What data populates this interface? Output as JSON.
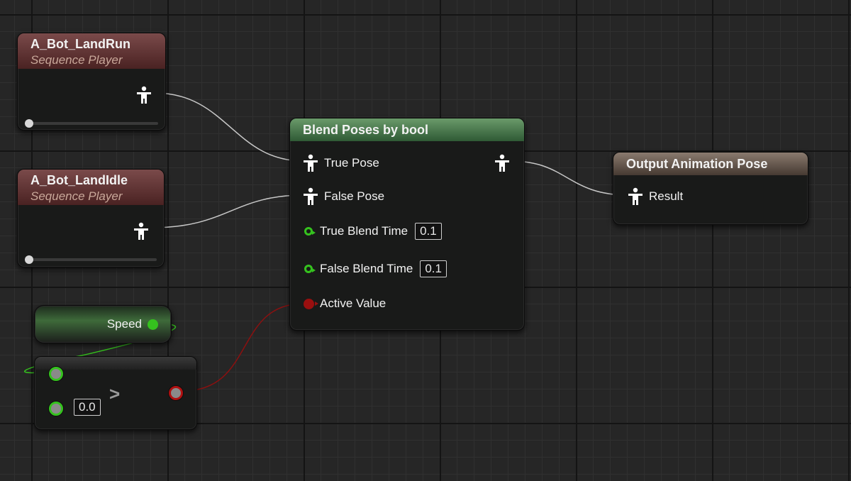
{
  "colors": {
    "graph_bg": "#262626",
    "float_pin": "#35c21e",
    "bool_pin": "#9a0f0f",
    "sequence_header": "#6e3e3e",
    "blend_header": "#4a7a4e",
    "output_header": "#7a6a60"
  },
  "nodes": {
    "land_run": {
      "title": "A_Bot_LandRun",
      "subtitle": "Sequence Player",
      "output_pin_icon": "pose-icon"
    },
    "land_idle": {
      "title": "A_Bot_LandIdle",
      "subtitle": "Sequence Player",
      "output_pin_icon": "pose-icon"
    },
    "blend": {
      "title": "Blend Poses by bool",
      "true_pose": "True Pose",
      "false_pose": "False Pose",
      "true_blend_time": "True Blend Time",
      "true_blend_value": "0.1",
      "false_blend_time": "False Blend Time",
      "false_blend_value": "0.1",
      "active_value": "Active Value"
    },
    "output": {
      "title": "Output Animation Pose",
      "result": "Result"
    },
    "speed": {
      "label": "Speed"
    },
    "compare": {
      "operator": ">",
      "b_value": "0.0"
    }
  }
}
